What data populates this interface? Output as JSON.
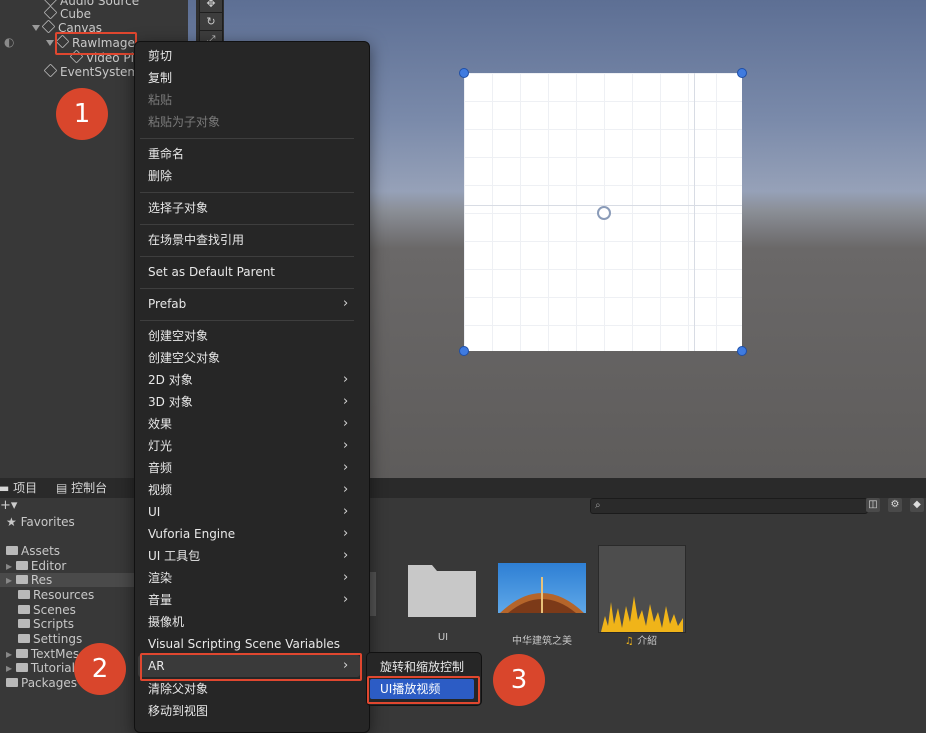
{
  "hierarchy": {
    "items": [
      {
        "label": "Audio Source"
      },
      {
        "label": "Cube"
      },
      {
        "label": "Canvas"
      },
      {
        "label": "RawImage"
      },
      {
        "label": "Video Pl"
      },
      {
        "label": "EventSystem"
      }
    ]
  },
  "project_panel": {
    "tabs": [
      {
        "label": "项目"
      },
      {
        "label": "控制台"
      }
    ],
    "favorites_label": "Favorites",
    "tree": [
      {
        "label": "Assets"
      },
      {
        "label": "Editor"
      },
      {
        "label": "Res"
      },
      {
        "label": "Resources"
      },
      {
        "label": "Scenes"
      },
      {
        "label": "Scripts"
      },
      {
        "label": "Settings"
      },
      {
        "label": "TextMes"
      },
      {
        "label": "Tutorial"
      },
      {
        "label": "Packages"
      }
    ],
    "assets": [
      {
        "label": "UI"
      },
      {
        "label": "中华建筑之美"
      },
      {
        "label": "介紹"
      }
    ]
  },
  "context_menu": {
    "items": [
      {
        "label": "剪切"
      },
      {
        "label": "复制"
      },
      {
        "label": "粘贴"
      },
      {
        "label": "粘贴为子对象"
      },
      {
        "label": "重命名"
      },
      {
        "label": "删除"
      },
      {
        "label": "选择子对象"
      },
      {
        "label": "在场景中查找引用"
      },
      {
        "label": "Set as Default Parent"
      },
      {
        "label": "Prefab"
      },
      {
        "label": "创建空对象"
      },
      {
        "label": "创建空父对象"
      },
      {
        "label": "2D 对象"
      },
      {
        "label": "3D 对象"
      },
      {
        "label": "效果"
      },
      {
        "label": "灯光"
      },
      {
        "label": "音频"
      },
      {
        "label": "视频"
      },
      {
        "label": "UI"
      },
      {
        "label": "Vuforia Engine"
      },
      {
        "label": "UI 工具包"
      },
      {
        "label": "渲染"
      },
      {
        "label": "音量"
      },
      {
        "label": "摄像机"
      },
      {
        "label": "Visual Scripting Scene Variables"
      },
      {
        "label": "AR"
      },
      {
        "label": "清除父对象"
      },
      {
        "label": "移动到视图"
      }
    ]
  },
  "ar_submenu": {
    "items": [
      {
        "label": "旋转和缩放控制"
      },
      {
        "label": "UI播放视频"
      }
    ]
  },
  "step_badges": [
    "1",
    "2",
    "3"
  ],
  "colors": {
    "highlight": "#2c5cc5",
    "annotation_red": "#e0472f",
    "badge_red": "#d9462c"
  }
}
